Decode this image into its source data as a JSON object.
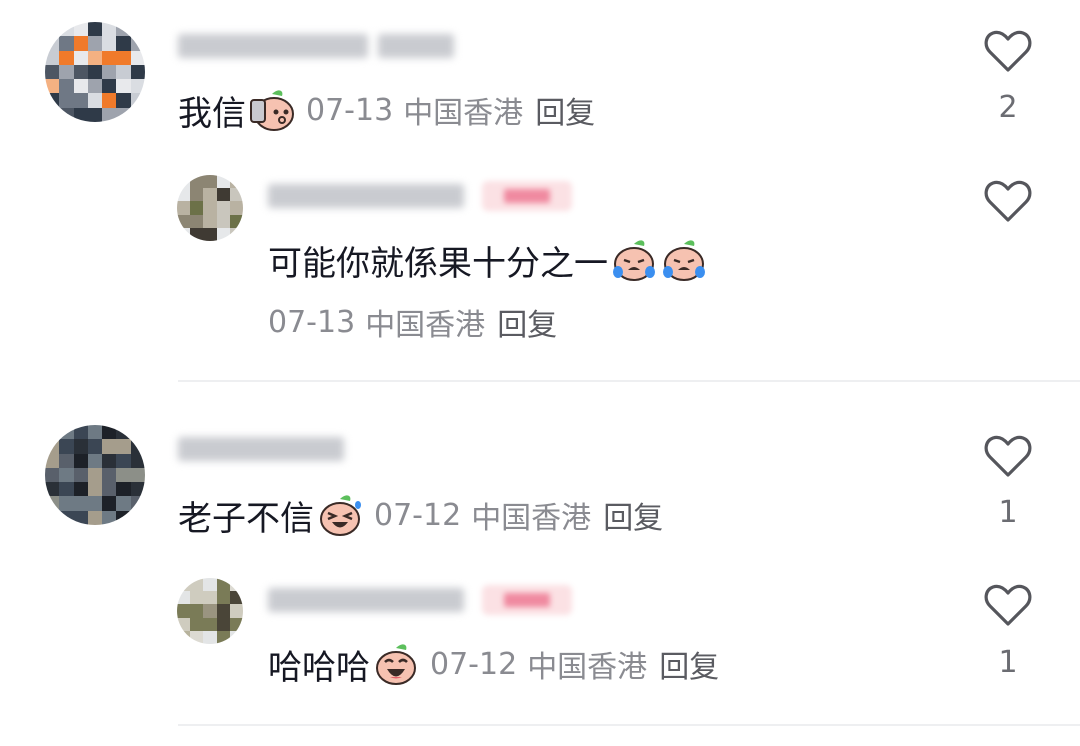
{
  "colors": {
    "text": "#161823",
    "meta": "#8a8b91",
    "reply": "#5a5b61",
    "divider": "#eeeff1"
  },
  "comments": [
    {
      "text": "我信",
      "emoji": [
        "peach-phone-emoji"
      ],
      "date": "07-13",
      "location": "中国香港",
      "reply_label": "回复",
      "like_count": "2",
      "reply": {
        "text": "可能你就係果十分之一",
        "emoji": [
          "peach-crying-emoji",
          "peach-crying-emoji"
        ],
        "date": "07-13",
        "location": "中国香港",
        "reply_label": "回复",
        "like_count": ""
      }
    },
    {
      "text": "老子不信",
      "emoji": [
        "peach-laughing-emoji"
      ],
      "date": "07-12",
      "location": "中国香港",
      "reply_label": "回复",
      "like_count": "1",
      "reply": {
        "text": "哈哈哈",
        "emoji": [
          "peach-grin-emoji"
        ],
        "date": "07-12",
        "location": "中国香港",
        "reply_label": "回复",
        "like_count": "1"
      }
    }
  ]
}
